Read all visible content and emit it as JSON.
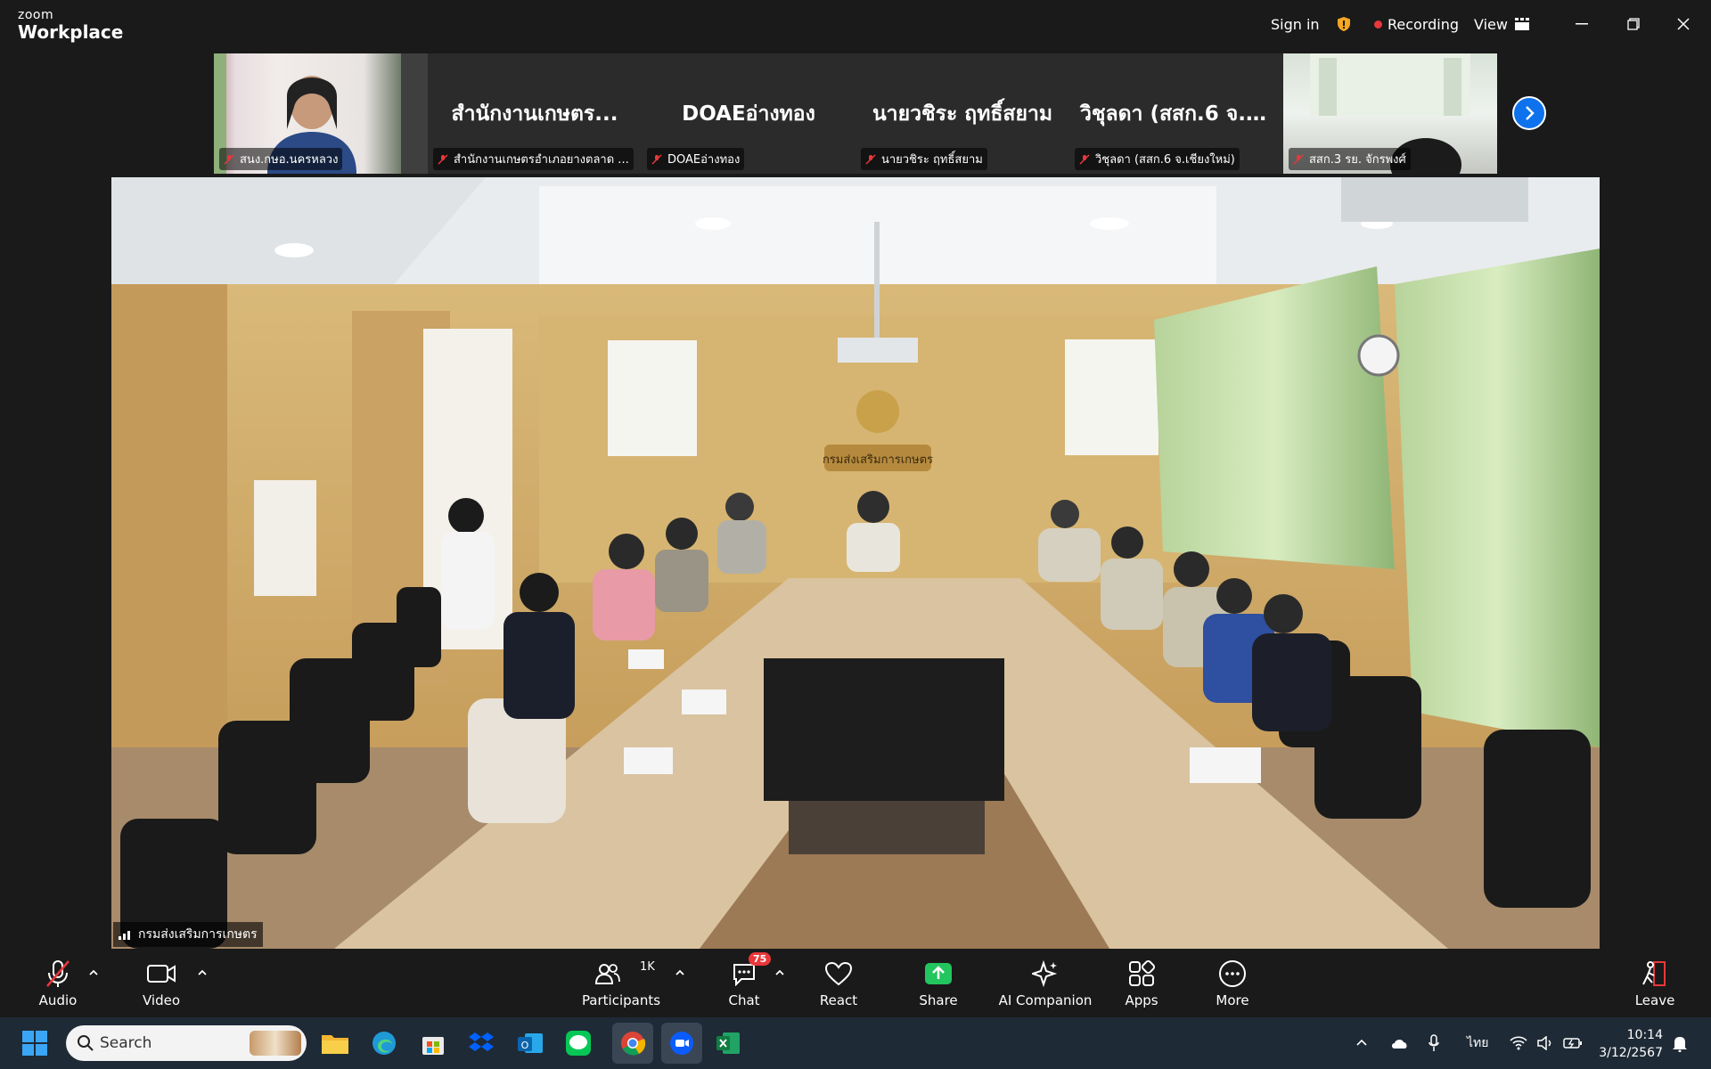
{
  "app": {
    "brand_top": "zoom",
    "brand_bottom": "Workplace"
  },
  "titlebar": {
    "sign_in": "Sign in",
    "recording": "Recording",
    "view": "View"
  },
  "gallery": [
    {
      "big_name": "",
      "label": "สนง.กษอ.นครหลวง",
      "video": true
    },
    {
      "big_name": "สำนักงานเกษตร...",
      "label": "สำนักงานเกษตรอำเภอยางตลาด ...",
      "video": false
    },
    {
      "big_name": "DOAEอ่างทอง",
      "label": "DOAEอ่างทอง",
      "video": false
    },
    {
      "big_name": "นายวชิระ ฤทธิ์สยาม",
      "label": "นายวชิระ ฤทธิ์สยาม",
      "video": false
    },
    {
      "big_name": "วิชุลดา (สสก.6 จ.เ...",
      "label": "วิชุลดา (สสก.6 จ.เชียงใหม่)",
      "video": false
    },
    {
      "big_name": "",
      "label": "สสก.3 รย. จักรพงศ์",
      "video": true
    }
  ],
  "main_video": {
    "name": "กรมส่งเสริมการเกษตร",
    "sign_text": "กรมส่งเสริมการเกษตร"
  },
  "controls": {
    "audio": "Audio",
    "video": "Video",
    "participants": "Participants",
    "participants_count": "1K",
    "chat": "Chat",
    "chat_badge": "75",
    "react": "React",
    "share": "Share",
    "ai_companion": "AI Companion",
    "apps": "Apps",
    "more": "More",
    "leave": "Leave"
  },
  "taskbar": {
    "search_placeholder": "Search",
    "language": "ไทย",
    "time": "10:14",
    "date": "3/12/2567"
  },
  "colors": {
    "accent": "#0e72ed",
    "record": "#e8383b",
    "share": "#23c55e",
    "leave": "#e8383b"
  }
}
